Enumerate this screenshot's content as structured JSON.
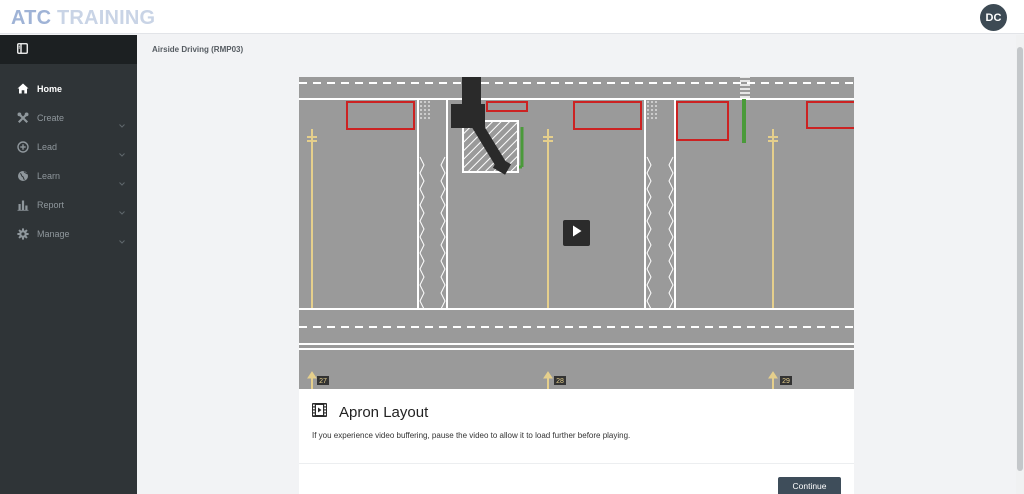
{
  "header": {
    "logo_primary": "ATC",
    "logo_secondary": "TRAINING",
    "avatar_initials": "DC"
  },
  "sidebar": {
    "toggle_icon": "sidebar-toggle-icon",
    "items": [
      {
        "label": "Home",
        "icon": "home-icon",
        "active": true,
        "expandable": false
      },
      {
        "label": "Create",
        "icon": "tools-icon",
        "active": false,
        "expandable": true
      },
      {
        "label": "Lead",
        "icon": "plus-circle-icon",
        "active": false,
        "expandable": true
      },
      {
        "label": "Learn",
        "icon": "globe-icon",
        "active": false,
        "expandable": true
      },
      {
        "label": "Report",
        "icon": "bar-chart-icon",
        "active": false,
        "expandable": true
      },
      {
        "label": "Manage",
        "icon": "gear-icon",
        "active": false,
        "expandable": true
      }
    ]
  },
  "main": {
    "page_title": "Airside Driving (RMP03)",
    "video": {
      "stand_numbers": [
        "27",
        "28",
        "29"
      ]
    },
    "lesson": {
      "icon": "film-icon",
      "title": "Apron Layout",
      "description": "If you experience video buffering, pause the video to allow it to load further before playing."
    },
    "continue_label": "Continue"
  }
}
